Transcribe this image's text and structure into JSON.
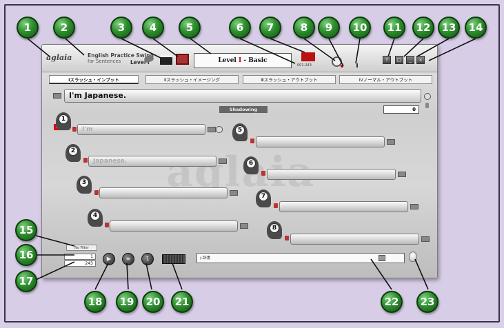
{
  "callouts": [
    "1",
    "2",
    "3",
    "4",
    "5",
    "6",
    "7",
    "8",
    "9",
    "10",
    "11",
    "12",
    "13",
    "14",
    "15",
    "16",
    "17",
    "18",
    "19",
    "20",
    "21",
    "22",
    "23"
  ],
  "app": {
    "logo_text": "aglaia",
    "product_line1": "English Practice Swing",
    "product_line2": "for Sentences",
    "product_level": "Level Ⅰ",
    "level_display": {
      "roman": "Ⅰ",
      "prefix": "Level ",
      "suffix": " - Basic"
    },
    "counter": "001-243",
    "window_buttons": [
      "?",
      "▢",
      "_",
      "×"
    ]
  },
  "tabs": [
    "Ⅰスラッシュ・インプット",
    "Ⅱスラッシュ・イメージング",
    "Ⅲスラッシュ・アウトプット",
    "Ⅳノーマル・アウトプット"
  ],
  "sentence": "I'm Japanese.",
  "score": "0",
  "shadowing_label": "Shadowing",
  "sv_badge": "SV",
  "slash_items": [
    {
      "num": "1",
      "text": "I'm"
    },
    {
      "num": "2",
      "text": "Japanese."
    },
    {
      "num": "3",
      "text": ""
    },
    {
      "num": "4",
      "text": ""
    },
    {
      "num": "5",
      "text": ""
    },
    {
      "num": "6",
      "text": ""
    },
    {
      "num": "7",
      "text": ""
    },
    {
      "num": "8",
      "text": ""
    }
  ],
  "watermark": "aglaia",
  "filter": "No Filter",
  "page_current": "1",
  "page_total": "243",
  "controls": {
    "play": "▶",
    "list": "≡",
    "one": "1"
  },
  "dictionary_label": "▷辞書"
}
